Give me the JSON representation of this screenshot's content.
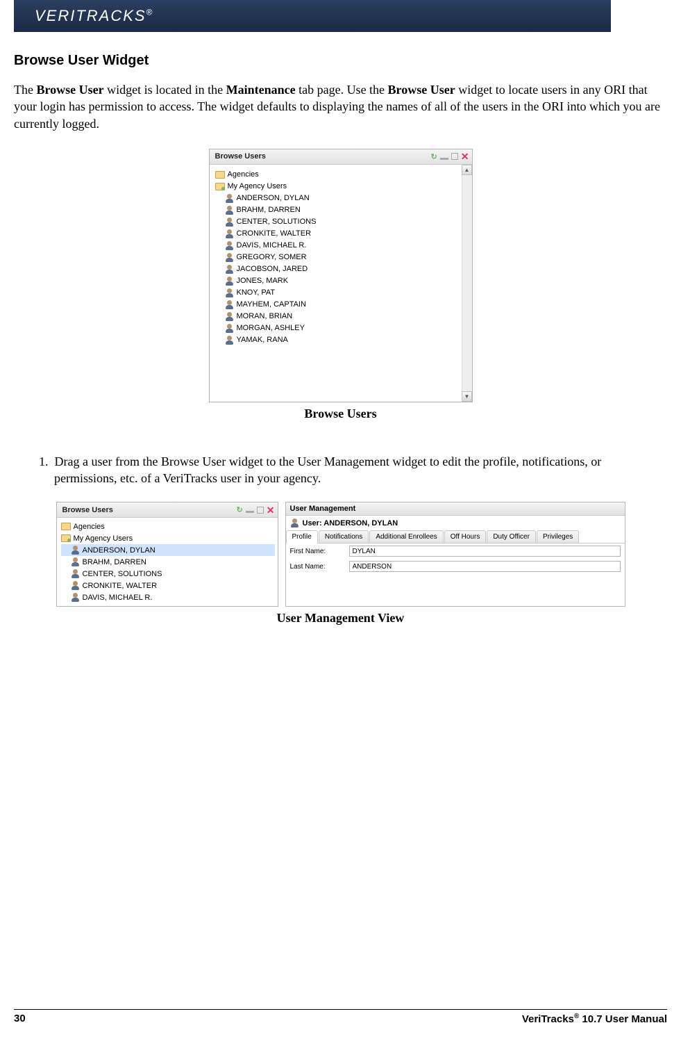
{
  "logo": {
    "text": "VERITRACKS",
    "mark": "®"
  },
  "section_title": "Browse User Widget",
  "intro": {
    "t1": "The ",
    "b1": "Browse User",
    "t2": " widget is located in the ",
    "b2": "Maintenance",
    "t3": " tab page.  Use the ",
    "b3": "Browse User",
    "t4": " widget to locate users in any ORI that your login has permission to access.  The widget defaults to displaying the names of all of the users in the ORI into which you are currently logged."
  },
  "browse1": {
    "title": "Browse Users",
    "agencies_label": "Agencies",
    "myagency_label": "My Agency Users",
    "users": [
      "ANDERSON, DYLAN",
      "BRAHM, DARREN",
      "CENTER, SOLUTIONS",
      "CRONKITE, WALTER",
      "DAVIS, MICHAEL R.",
      "GREGORY, SOMER",
      "JACOBSON, JARED",
      "JONES, MARK",
      "KNOY, PAT",
      "MAYHEM, CAPTAIN",
      "MORAN, BRIAN",
      "MORGAN, ASHLEY",
      "YAMAK, RANA"
    ]
  },
  "caption1": "Browse Users",
  "step1": {
    "num": "1.",
    "text": "Drag a user from the Browse User widget to the User Management widget to edit the profile, notifications, or permissions, etc. of a VeriTracks user in your agency."
  },
  "browse2": {
    "title": "Browse Users",
    "agencies_label": "Agencies",
    "myagency_label": "My Agency Users",
    "users": [
      "ANDERSON, DYLAN",
      "BRAHM, DARREN",
      "CENTER, SOLUTIONS",
      "CRONKITE, WALTER",
      "DAVIS, MICHAEL R."
    ],
    "selected_index": 0
  },
  "um": {
    "title": "User Management",
    "user_prefix": "User: ",
    "user_name": "ANDERSON, DYLAN",
    "tabs": [
      "Profile",
      "Notifications",
      "Additional Enrollees",
      "Off Hours",
      "Duty Officer",
      "Privileges"
    ],
    "first_name_label": "First Name:",
    "first_name_value": "DYLAN",
    "last_name_label": "Last Name:",
    "last_name_value": "ANDERSON"
  },
  "caption2": "User Management View",
  "footer": {
    "page": "30",
    "product": "VeriTracks",
    "mark": "®",
    "rest": " 10.7 User Manual"
  }
}
